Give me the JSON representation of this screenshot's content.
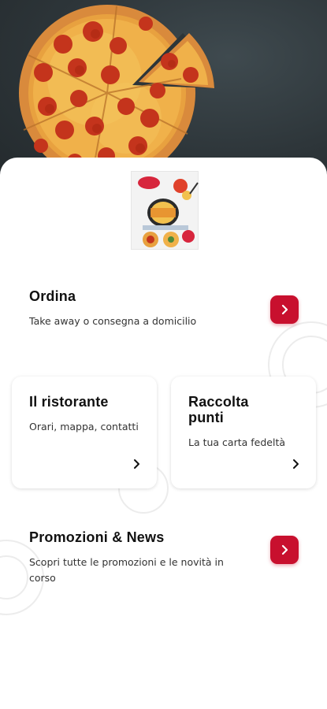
{
  "colors": {
    "accent": "#c8102e",
    "hero_background": "#2f383c"
  },
  "hero": {
    "image": "pepperoni-pizza-photo"
  },
  "logo": {
    "image": "pizza-app-logo"
  },
  "order": {
    "title": "Ordina",
    "subtitle": "Take away o consegna a domicilio",
    "button_icon": "chevron-right-icon"
  },
  "cards": {
    "restaurant": {
      "title": "Il ristorante",
      "subtitle": "Orari, mappa, contatti",
      "icon": "chevron-right-icon"
    },
    "points": {
      "title_line1": "Raccolta",
      "title_line2": "punti",
      "subtitle": "La tua carta fedeltà",
      "icon": "chevron-right-icon"
    }
  },
  "promotions": {
    "title": "Promozioni & News",
    "subtitle_line1": "Scopri tutte le promozioni e le novità in",
    "subtitle_line2": "corso",
    "button_icon": "chevron-right-icon"
  }
}
